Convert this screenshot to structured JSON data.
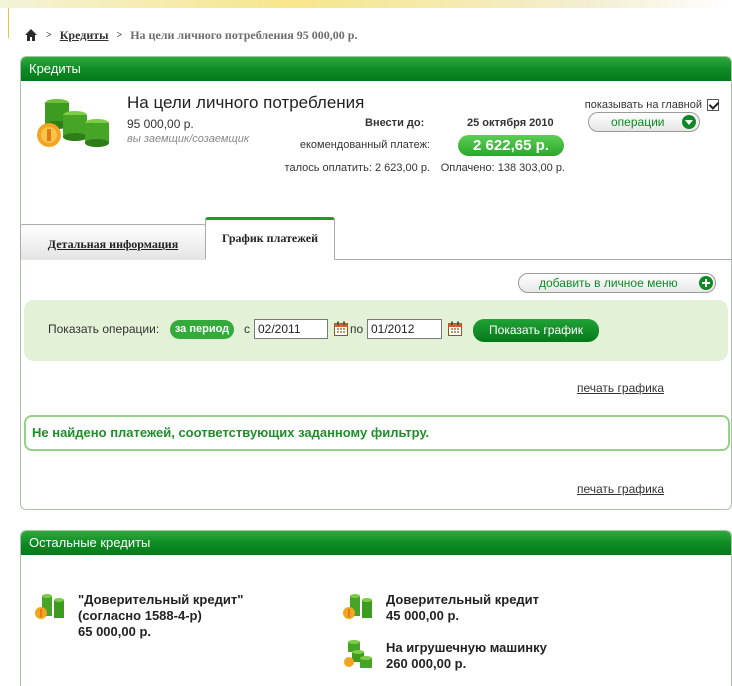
{
  "breadcrumb": {
    "home_icon": "home-icon",
    "separator": ">",
    "link": "Кредиты",
    "current": "На цели личного потребления 95 000,00 р."
  },
  "credit_panel": {
    "header": "Кредиты",
    "title": "На цели личного потребления",
    "amount": "95 000,00 р.",
    "role": "вы заемщик/созаемщик",
    "due_label": "Внести до:",
    "due_date": "25 октября 2010",
    "recommended_label": "екомендованный платеж:",
    "recommended_amount": "2 622,65 р.",
    "remaining": "талось оплатить: 2 623,00 р.",
    "paid": "Оплачено: 138 303,00 р.",
    "show_on_main": "показывать на главной",
    "show_on_main_checked": true,
    "operations_button": "операции"
  },
  "tabs": [
    {
      "label": "Детальная информация",
      "active": false
    },
    {
      "label": "График платежей",
      "active": true
    }
  ],
  "schedule": {
    "add_to_menu": "добавить в личное меню",
    "filter_label": "Показать операции:",
    "period_badge": "за период",
    "from_label": "с",
    "from_value": "02/2011",
    "to_label": "по",
    "to_value": "01/2012",
    "show_button": "Показать график",
    "print_link": "печать графика",
    "empty_message": "Не найдено платежей, соответствующих заданному фильтру."
  },
  "other_credits": {
    "header": "Остальные кредиты",
    "items": [
      {
        "name": "\"Доверительный кредит\" (согласно 1588-4-р)",
        "amount": "65 000,00 р.",
        "icon": "coins-icon"
      },
      {
        "name": "Доверительный кредит",
        "amount": "45 000,00 р.",
        "icon": "coins-icon"
      },
      {
        "name": "На игрушечную машинку",
        "amount": "260 000,00 р.",
        "icon": "coins-stack-icon"
      }
    ]
  },
  "colors": {
    "brand_green": "#0c8a23",
    "light_green_bg": "#e3f1d6",
    "message_green": "#1f8f2a"
  }
}
